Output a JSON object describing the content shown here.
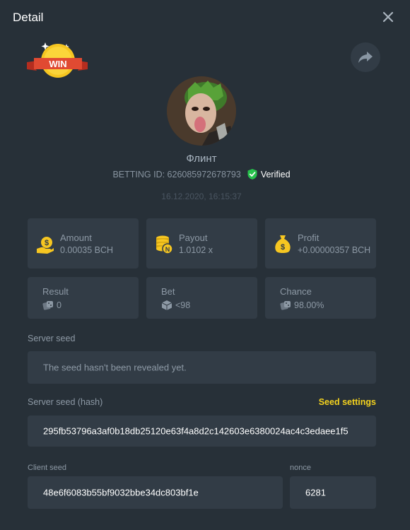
{
  "header": {
    "title": "Detail"
  },
  "badge": {
    "text": "WIN"
  },
  "user": {
    "name": "Флинт",
    "betting_id_label": "BETTING ID: 626085972678793",
    "verified_label": "Verified",
    "timestamp": "16.12.2020, 16:15:37"
  },
  "stats": [
    {
      "label": "Amount",
      "value": "0.00035 BCH",
      "icon": "money-hand-icon"
    },
    {
      "label": "Payout",
      "value": "1.0102 x",
      "icon": "coin-stack-icon"
    },
    {
      "label": "Profit",
      "value": "+0.00000357 BCH",
      "icon": "money-bag-icon"
    },
    {
      "label": "Result",
      "value": "0",
      "icon": "dice-icon"
    },
    {
      "label": "Bet",
      "value": "<98",
      "icon": "die-icon"
    },
    {
      "label": "Chance",
      "value": "98.00%",
      "icon": "dice-icon"
    }
  ],
  "server_seed": {
    "label": "Server seed",
    "value": "The seed hasn't been revealed yet."
  },
  "server_seed_hash": {
    "label": "Server seed (hash)",
    "settings_label": "Seed settings",
    "value": "295fb53796a3af0b18db25120e63f4a8d2c142603e6380024ac4c3edaee1f5"
  },
  "client_seed": {
    "label": "Client seed",
    "value": "48e6f6083b55bf9032bbe34dc803bf1e"
  },
  "nonce": {
    "label": "nonce",
    "value": "6281"
  },
  "colors": {
    "background": "#273038",
    "card": "#323c46",
    "accent_yellow": "#f5d31e",
    "verified_green": "#27c24c",
    "badge_red": "#d9412e"
  }
}
